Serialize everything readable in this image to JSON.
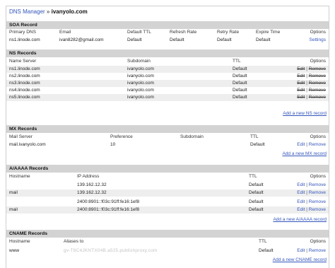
{
  "breadcrumb": {
    "link": "DNS Manager",
    "separator": "»",
    "domain": "ivanyolo.com"
  },
  "actions": {
    "edit": "Edit",
    "remove": "Remove",
    "divider": "|"
  },
  "soa": {
    "title": "SOA Record",
    "headers": [
      "Primary DNS",
      "Email",
      "Default TTL",
      "Refresh Rate",
      "Retry Rate",
      "Expire Time",
      "Options"
    ],
    "row": {
      "primary": "ns1.linode.com",
      "email": "ivan8282@gmail.com",
      "ttl": "Default",
      "refresh": "Default",
      "retry": "Default",
      "expire": "Default",
      "option": "Settings"
    }
  },
  "ns": {
    "title": "NS Records",
    "headers": [
      "Name Server",
      "Subdomain",
      "TTL",
      "Options"
    ],
    "rows": [
      {
        "server": "ns1.linode.com",
        "subdomain": "ivanyolo.com",
        "ttl": "Default"
      },
      {
        "server": "ns2.linode.com",
        "subdomain": "ivanyolo.com",
        "ttl": "Default"
      },
      {
        "server": "ns3.linode.com",
        "subdomain": "ivanyolo.com",
        "ttl": "Default"
      },
      {
        "server": "ns4.linode.com",
        "subdomain": "ivanyolo.com",
        "ttl": "Default"
      },
      {
        "server": "ns5.linode.com",
        "subdomain": "ivanyolo.com",
        "ttl": "Default"
      }
    ],
    "add": "Add a new NS record"
  },
  "mx": {
    "title": "MX Records",
    "headers": [
      "Mail Server",
      "Preference",
      "Subdomain",
      "TTL",
      "Options"
    ],
    "rows": [
      {
        "server": "mail.ivanyolo.com",
        "preference": "10",
        "subdomain": "",
        "ttl": "Default"
      }
    ],
    "add": "Add a new MX record"
  },
  "a": {
    "title": "A/AAAA Records",
    "headers": [
      "Hostname",
      "IP Address",
      "TTL",
      "Options"
    ],
    "rows": [
      {
        "host": "",
        "ip": "139.162.12.32",
        "ttl": "Default"
      },
      {
        "host": "mail",
        "ip": "139.162.12.32",
        "ttl": "Default"
      },
      {
        "host": "",
        "ip": "2400:8901::f03c:91ff:fe16:1ef8",
        "ttl": "Default"
      },
      {
        "host": "mail",
        "ip": "2400:8901::f03c:91ff:fe16:1ef8",
        "ttl": "Default"
      }
    ],
    "add": "Add a new A/AAAA record"
  },
  "cname": {
    "title": "CNAME Records",
    "headers": [
      "Hostname",
      "Aliases to",
      "TTL",
      "Options"
    ],
    "rows": [
      {
        "host": "www",
        "alias": "gv-T8C4JKNTX04B.a525.publishproxy.com",
        "ttl": "Default"
      }
    ],
    "add": "Add a new CNAME record"
  }
}
